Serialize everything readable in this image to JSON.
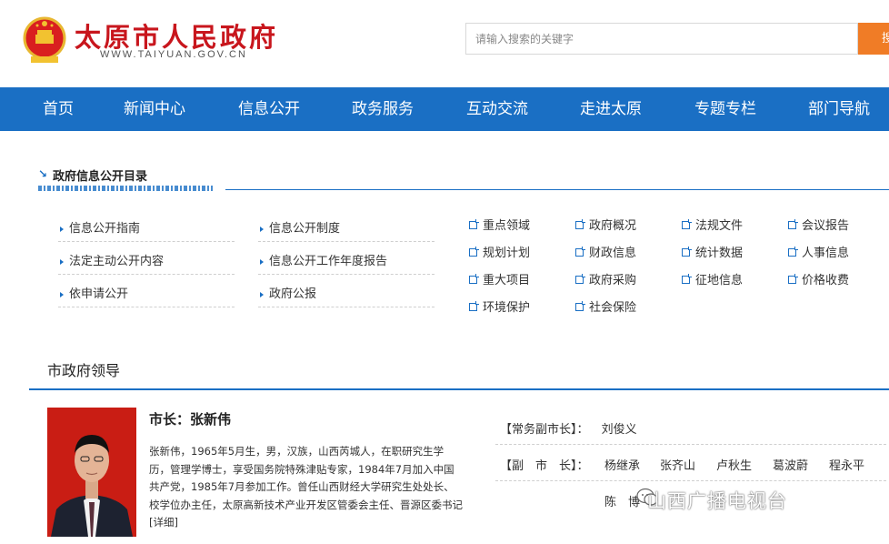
{
  "header": {
    "title": "太原市人民政府",
    "domain": "WWW.TAIYUAN.GOV.CN",
    "search_placeholder": "请输入搜索的关键字",
    "search_button": "搜索"
  },
  "nav": [
    "首页",
    "新闻中心",
    "信息公开",
    "政务服务",
    "互动交流",
    "走进太原",
    "专题专栏",
    "部门导航"
  ],
  "directory": {
    "title": "政府信息公开目录",
    "links_col1": [
      "信息公开指南",
      "法定主动公开内容",
      "依申请公开"
    ],
    "links_col2": [
      "信息公开制度",
      "信息公开工作年度报告",
      "政府公报"
    ],
    "categories": [
      [
        "重点领域",
        "政府概况",
        "法规文件",
        "会议报告"
      ],
      [
        "规划计划",
        "财政信息",
        "统计数据",
        "人事信息"
      ],
      [
        "重大项目",
        "政府采购",
        "征地信息",
        "价格收费"
      ],
      [
        "环境保护",
        "社会保险"
      ]
    ]
  },
  "leaders": {
    "title": "市政府领导",
    "mayor_title": "市长：张新伟",
    "mayor_bio": "张新伟，1965年5月生，男，汉族，山西芮城人，在职研究生学历，管理学博士，享受国务院特殊津贴专家，1984年7月加入中国共产党，1985年7月参加工作。曾任山西财经大学研究生处处长、校学位办主任，太原高新技术产业开发区管委会主任、晋源区委书记",
    "more_link": "[详细]",
    "exec_vice_label": "【常务副市长】：",
    "exec_vice_name": "刘俊义",
    "vice_label": "【副　市　长】：",
    "vice_names": [
      "杨继承",
      "张齐山",
      "卢秋生",
      "葛波蔚",
      "程永平"
    ],
    "vice_names_row2": [
      "陈　博"
    ]
  },
  "watermark": "山西广播电视台",
  "colors": {
    "brand_red": "#c8161d",
    "nav_blue": "#1a6fc4",
    "search_orange": "#f07c26"
  }
}
